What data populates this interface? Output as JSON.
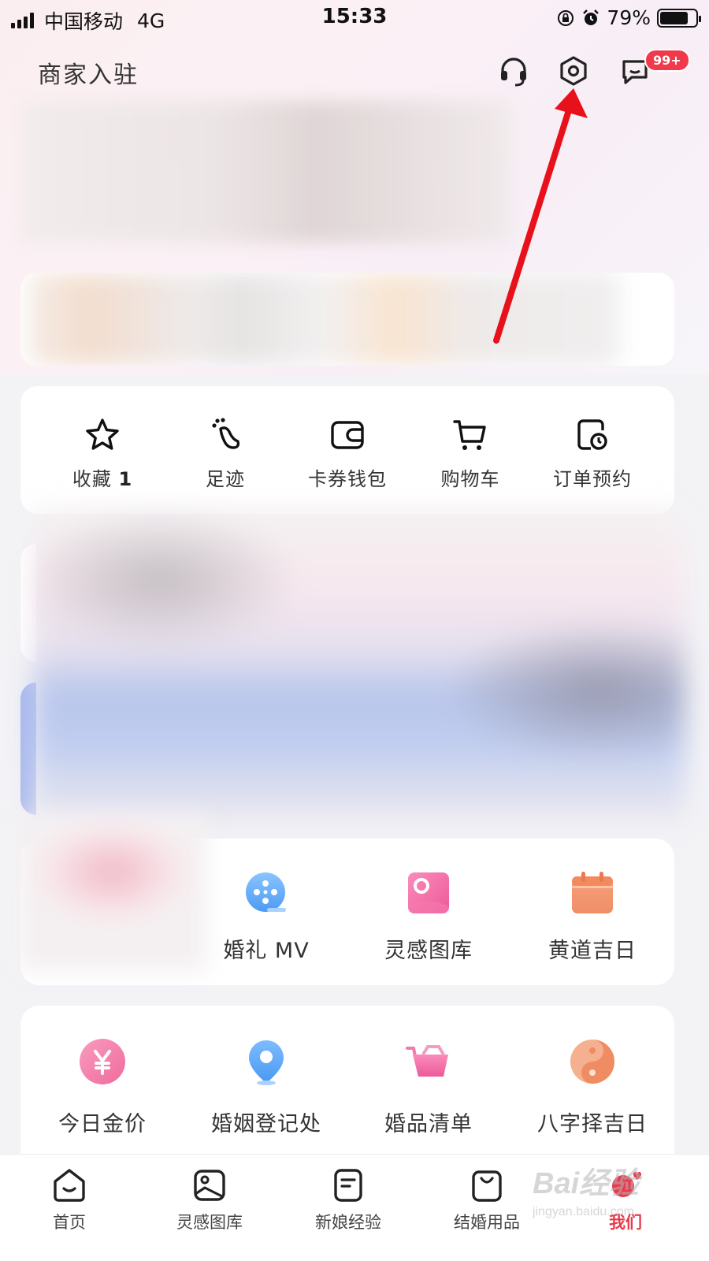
{
  "status_bar": {
    "carrier": "中国移动",
    "network": "4G",
    "time": "15:33",
    "battery": "79%",
    "battery_level": 0.79
  },
  "header": {
    "merchant_link": "商家入驻",
    "message_badge": "99+",
    "icons": [
      "headset-icon",
      "settings-icon",
      "message-icon"
    ]
  },
  "quick_actions": [
    {
      "label": "收藏",
      "count": "1",
      "icon": "star-icon"
    },
    {
      "label": "足迹",
      "icon": "footprint-icon"
    },
    {
      "label": "卡券钱包",
      "icon": "wallet-icon"
    },
    {
      "label": "购物车",
      "icon": "cart-icon"
    },
    {
      "label": "订单预约",
      "icon": "order-clock-icon"
    }
  ],
  "tools": [
    {
      "label": "婚礼 MV",
      "icon": "film-reel-icon"
    },
    {
      "label": "灵感图库",
      "icon": "gallery-icon"
    },
    {
      "label": "黄道吉日",
      "icon": "calendar-icon"
    }
  ],
  "services": [
    {
      "label": "今日金价",
      "icon": "yuan-icon"
    },
    {
      "label": "婚姻登记处",
      "icon": "location-pin-icon"
    },
    {
      "label": "婚品清单",
      "icon": "shopping-basket-icon"
    },
    {
      "label": "八字择吉日",
      "icon": "yin-yang-icon"
    }
  ],
  "bottom_nav": [
    {
      "label": "首页",
      "icon": "home-icon"
    },
    {
      "label": "灵感图库",
      "icon": "image-icon"
    },
    {
      "label": "新娘经验",
      "icon": "note-icon"
    },
    {
      "label": "结婚用品",
      "icon": "bag-icon"
    },
    {
      "label": "我们",
      "icon": "couple-heart-icon",
      "active": true
    }
  ],
  "watermark": {
    "main": "Bai经验",
    "sub": "jingyan.baidu.com"
  },
  "colors": {
    "accent_red": "#f03a4c",
    "annotation_arrow": "#e8101a",
    "pink_icon": "#f06ea0",
    "blue_icon": "#5aa8f5",
    "orange_icon": "#f2946a"
  }
}
